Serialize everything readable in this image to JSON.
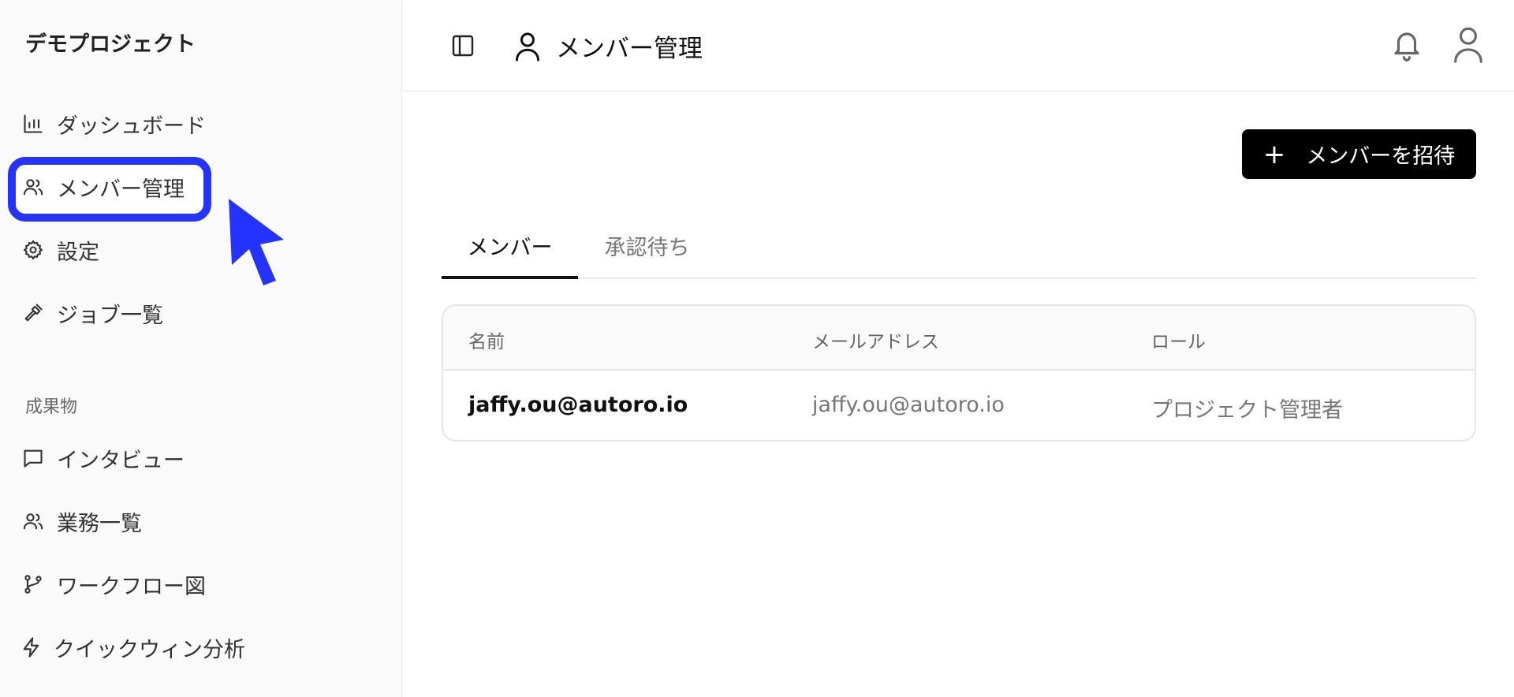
{
  "sidebar": {
    "project_title": "デモプロジェクト",
    "items": [
      {
        "label": "ダッシュボード",
        "icon": "bar-chart-icon"
      },
      {
        "label": "メンバー管理",
        "icon": "users-icon"
      },
      {
        "label": "設定",
        "icon": "gear-icon"
      },
      {
        "label": "ジョブ一覧",
        "icon": "hammer-icon"
      }
    ],
    "section_label": "成果物",
    "section_items": [
      {
        "label": "インタビュー",
        "icon": "chat-icon"
      },
      {
        "label": "業務一覧",
        "icon": "users-icon"
      },
      {
        "label": "ワークフロー図",
        "icon": "git-branch-icon"
      },
      {
        "label": "クイックウィン分析",
        "icon": "lightning-icon"
      }
    ]
  },
  "header": {
    "title": "メンバー管理"
  },
  "main": {
    "invite_button": "メンバーを招待",
    "tabs": [
      "メンバー",
      "承認待ち"
    ],
    "table": {
      "headers": [
        "名前",
        "メールアドレス",
        "ロール"
      ],
      "rows": [
        {
          "name": "jaffy.ou@autoro.io",
          "email": "jaffy.ou@autoro.io",
          "role": "プロジェクト管理者"
        }
      ]
    }
  },
  "colors": {
    "highlight": "#2433ff",
    "button_bg": "#000000"
  }
}
